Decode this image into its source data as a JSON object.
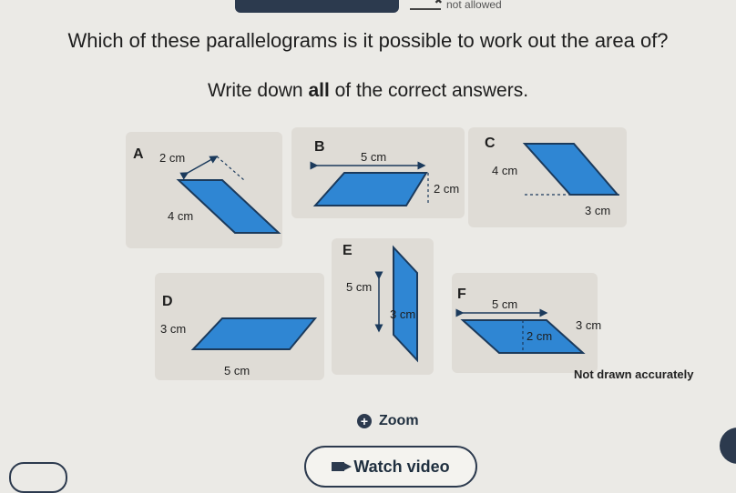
{
  "top": {
    "not_allowed": "not allowed"
  },
  "question": {
    "line1": "Which of these parallelograms is it possible to work out the area of?",
    "line2_pre": "Write down ",
    "line2_bold": "all",
    "line2_post": " of the correct answers."
  },
  "shapes": {
    "A": {
      "letter": "A",
      "labels": [
        "2 cm",
        "4 cm"
      ]
    },
    "B": {
      "letter": "B",
      "labels": [
        "5 cm",
        "2 cm"
      ]
    },
    "C": {
      "letter": "C",
      "labels": [
        "4 cm",
        "3 cm"
      ]
    },
    "D": {
      "letter": "D",
      "labels": [
        "3 cm",
        "5 cm"
      ]
    },
    "E": {
      "letter": "E",
      "labels": [
        "5 cm",
        "3 cm"
      ]
    },
    "F": {
      "letter": "F",
      "labels": [
        "5 cm",
        "2 cm",
        "3 cm"
      ]
    }
  },
  "note": "Not drawn accurately",
  "zoom_label": "Zoom",
  "watch_label": "Watch video",
  "colors": {
    "shape_fill": "#2f86d3",
    "shape_stroke": "#1b3a5c",
    "dark": "#2c3a4e"
  }
}
